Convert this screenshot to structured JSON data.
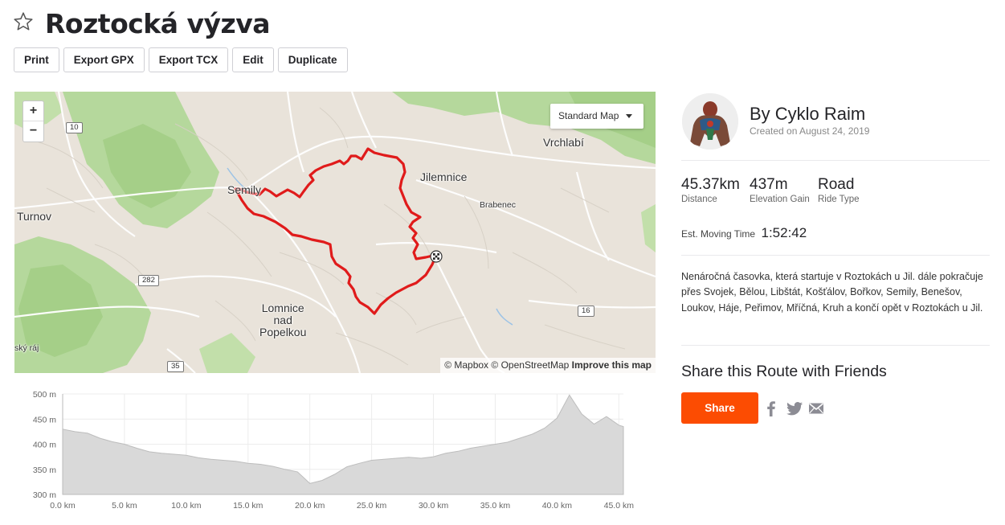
{
  "route": {
    "title": "Roztocká výzva"
  },
  "toolbar": {
    "print": "Print",
    "export_gpx": "Export GPX",
    "export_tcx": "Export TCX",
    "edit": "Edit",
    "duplicate": "Duplicate"
  },
  "map": {
    "zoom_in": "+",
    "zoom_out": "−",
    "map_type": "Standard Map",
    "attribution": {
      "mapbox": "© Mapbox",
      "osm": "© OpenStreetMap",
      "improve": "Improve this map"
    },
    "places": {
      "semily": "Semily",
      "jilemnice": "Jilemnice",
      "vrchlabi": "Vrchlabí",
      "turnov": "Turnov",
      "brabenec": "Brabenec",
      "lomnice": "Lomnice\nnad\nPopelkou",
      "cesky_raj": "ský ráj"
    },
    "road_shields": {
      "r10": "10",
      "r282": "282",
      "r16": "16",
      "r35": "35"
    },
    "colors": {
      "route": "#e01b1b",
      "forest": "#a8d08d",
      "land": "#e9e3da"
    }
  },
  "elevation": {
    "y_ticks": [
      "500 m",
      "450 m",
      "400 m",
      "350 m",
      "300 m"
    ],
    "x_ticks": [
      "0.0 km",
      "5.0 km",
      "10.0 km",
      "15.0 km",
      "20.0 km",
      "25.0 km",
      "30.0 km",
      "35.0 km",
      "40.0 km",
      "45.0 km"
    ]
  },
  "chart_data": {
    "type": "area",
    "title": "",
    "xlabel": "",
    "ylabel": "",
    "xlim": [
      0,
      45.37
    ],
    "ylim": [
      300,
      500
    ],
    "x": [
      0,
      1,
      2,
      3,
      4,
      5,
      6,
      7,
      8,
      9,
      10,
      11,
      12,
      13,
      14,
      15,
      16,
      17,
      18,
      19,
      20,
      21,
      22,
      23,
      24,
      25,
      26,
      27,
      28,
      29,
      30,
      31,
      32,
      33,
      34,
      35,
      36,
      37,
      38,
      39,
      40,
      41,
      42,
      43,
      44,
      45,
      45.37
    ],
    "series": [
      {
        "values": [
          430,
          425,
          422,
          412,
          405,
          400,
          392,
          385,
          382,
          380,
          378,
          373,
          370,
          368,
          366,
          362,
          360,
          356,
          350,
          345,
          322,
          328,
          340,
          355,
          362,
          368,
          370,
          372,
          374,
          372,
          375,
          382,
          386,
          392,
          396,
          400,
          404,
          412,
          420,
          432,
          452,
          498,
          460,
          440,
          455,
          438,
          435
        ]
      }
    ],
    "colors": {
      "fill": "#d9d9d9",
      "line": "#bdbdbd"
    }
  },
  "sidebar": {
    "author": "By Cyklo Raim",
    "created": "Created on August 24, 2019",
    "stats": [
      {
        "value": "45.37km",
        "label": "Distance"
      },
      {
        "value": "437m",
        "label": "Elevation Gain"
      },
      {
        "value": "Road",
        "label": "Ride Type"
      }
    ],
    "moving_time_label": "Est. Moving Time",
    "moving_time": "1:52:42",
    "description": "Nenáročná časovka, která startuje v Roztokách u Jil. dále pokračuje přes Svojek, Bělou, Libštát, Košťálov, Bořkov, Semily, Benešov, Loukov, Háje, Peřimov, Mříčná, Kruh a končí opět v Roztokách u Jil.",
    "share_title": "Share this Route with Friends",
    "share_button": "Share",
    "accent": "#fc4c02"
  }
}
